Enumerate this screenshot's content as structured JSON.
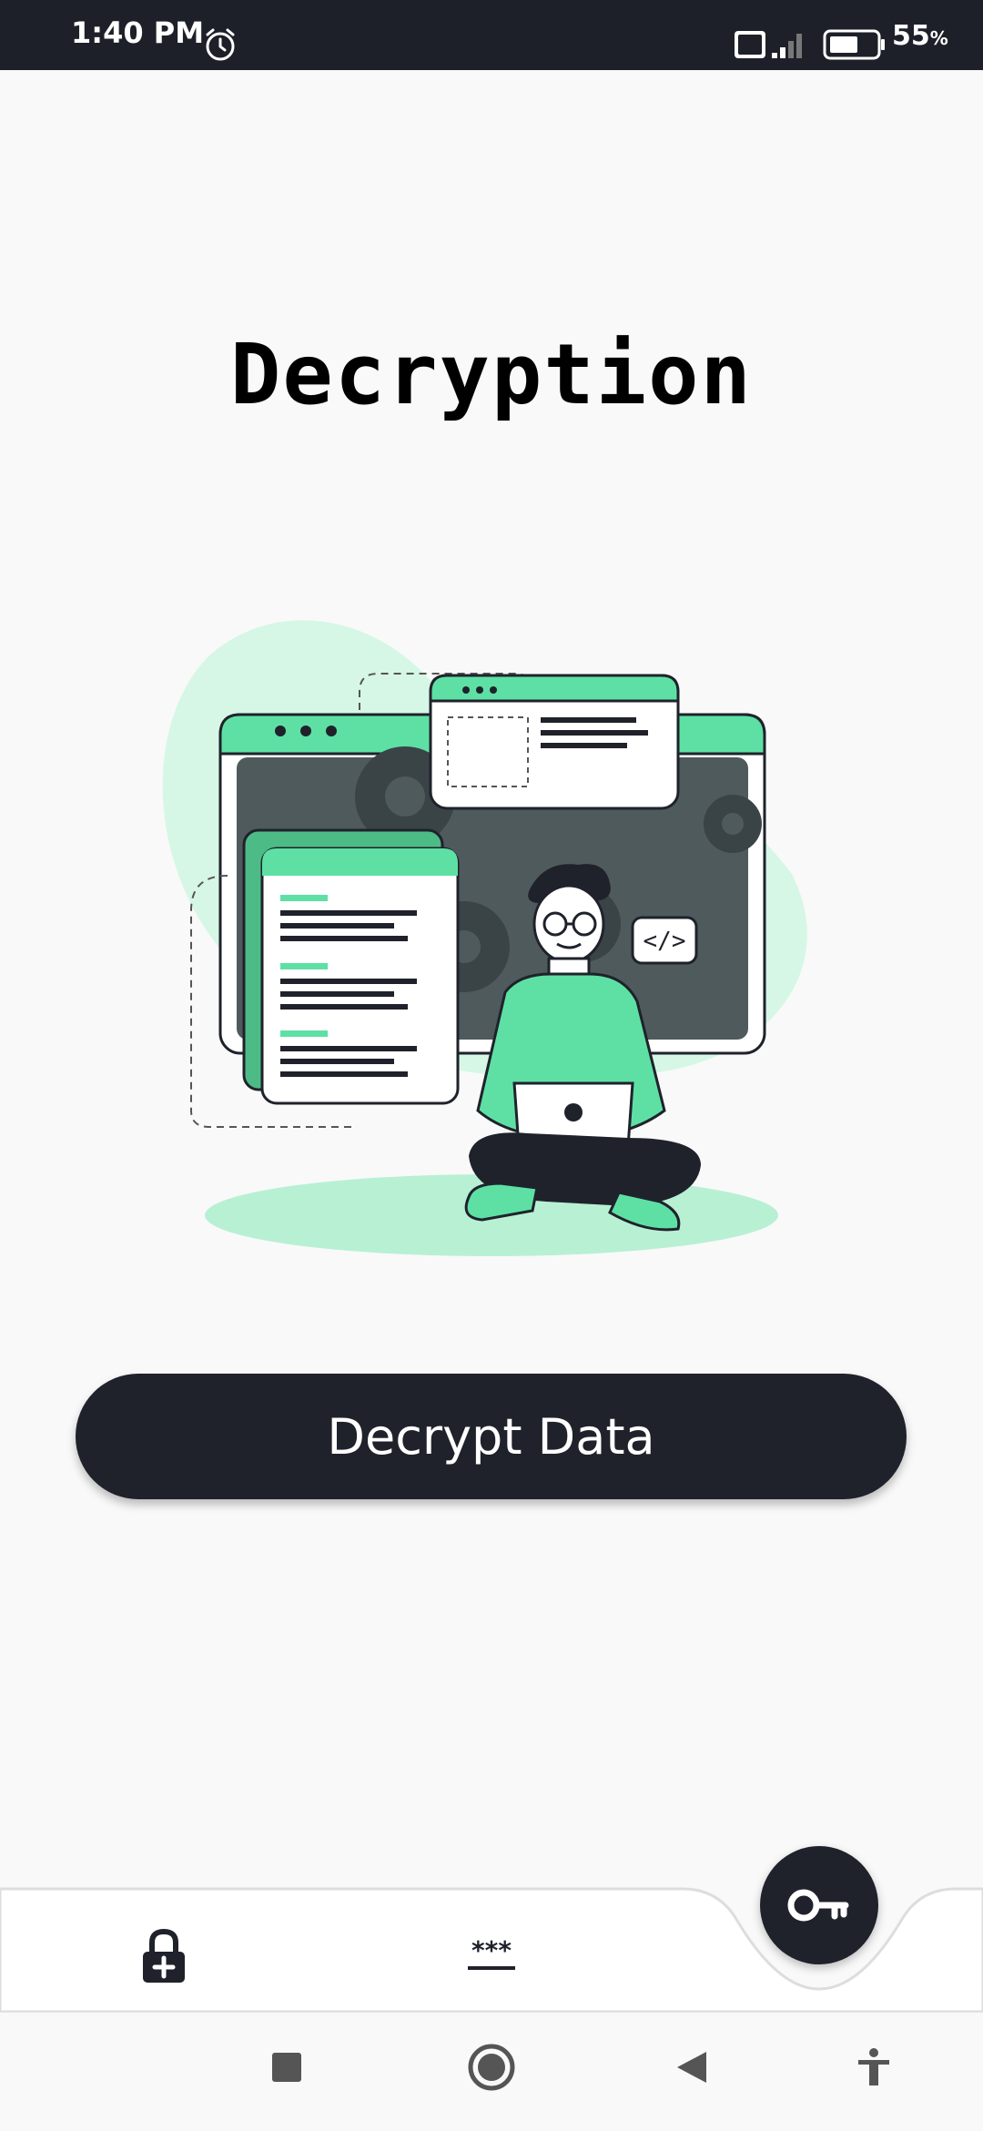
{
  "status_bar": {
    "time": "1:40 PM",
    "battery_percent": "55",
    "battery_percent_sign": "%",
    "battery_level": 0.55,
    "icons": [
      "alarm-icon",
      "volte-icon",
      "signal-icon",
      "battery-icon"
    ]
  },
  "main": {
    "title": "Decryption",
    "illustration_icon": "person-with-laptop-code-illustration",
    "decrypt_button_label": "Decrypt Data"
  },
  "bottom_nav": {
    "items": [
      {
        "icon": "lock-plus-icon"
      },
      {
        "icon": "password-asterisk-icon"
      }
    ],
    "fab_icon": "key-icon"
  },
  "system_nav": {
    "icons": [
      "recents-square-icon",
      "home-circle-icon",
      "back-triangle-icon",
      "accessibility-icon"
    ]
  },
  "colors": {
    "status_bar_bg": "#1e2029",
    "dark": "#1f222b",
    "accent_green": "#5ee0a5",
    "light_green": "#d6f7e6",
    "background": "#f9f9f9"
  }
}
